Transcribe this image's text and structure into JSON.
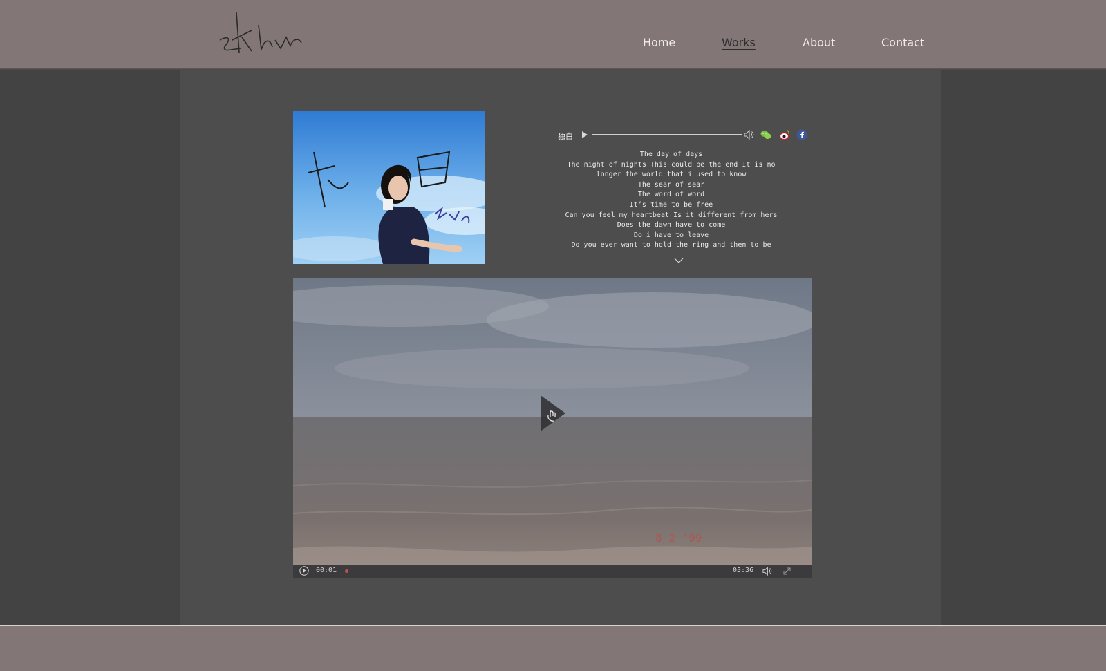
{
  "header": {
    "logo_text": "zkhc",
    "nav": [
      {
        "label": "Home",
        "active": false
      },
      {
        "label": "Works",
        "active": true
      },
      {
        "label": "About",
        "active": false
      },
      {
        "label": "Contact",
        "active": false
      }
    ]
  },
  "album": {
    "art_title": "独白",
    "art_signature": "zkhc"
  },
  "audio": {
    "title": "独白",
    "icons": [
      "play-icon",
      "volume-icon",
      "wechat-icon",
      "weibo-icon",
      "facebook-icon"
    ]
  },
  "lyrics": [
    "The day of days",
    "The night of nights This could be the end It is no",
    "longer the world that i used to know",
    "The sear of sear",
    "The word of word",
    "It’s time to be free",
    "Can you feel my heartbeat Is it different from hers",
    "Does the dawn have to come",
    "Do i have to leave",
    "Do you ever want to hold the ring and then to be"
  ],
  "video": {
    "current_time": "00:01",
    "duration": "03:36",
    "date_stamp": "8  2 '99",
    "progress": 0.005
  },
  "colors": {
    "header_bg": "#837676",
    "content_bg": "#4e4d4e",
    "side_bg": "#434343",
    "accent_red": "#c85050"
  }
}
